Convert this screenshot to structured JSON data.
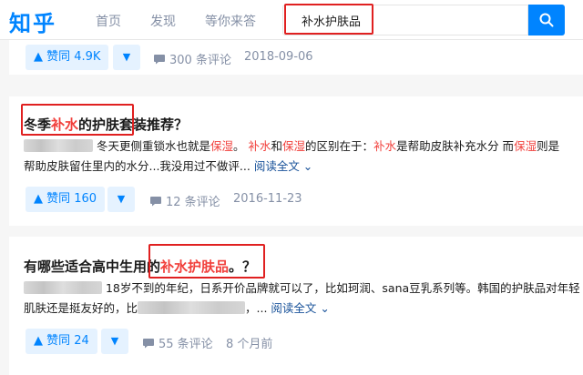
{
  "header": {
    "logo": "知乎",
    "nav": [
      "首页",
      "发现",
      "等你来答"
    ],
    "search_value": "补水护肤品"
  },
  "colors": {
    "brand": "#0084ff",
    "highlight": "#f1403c",
    "annotation": "#e02020"
  },
  "card0": {
    "vote_label": "▲ 赞同 4.9K",
    "vote_down": "▼",
    "comments": "300 条评论",
    "date": "2018-09-06"
  },
  "card1": {
    "title": {
      "a": "冬季",
      "hl": "补水",
      "b": "的护肤套装推荐？"
    },
    "line1": {
      "a": "冬天更侧重锁水也就是",
      "h1": "保湿",
      "b": "。 ",
      "h2": "补水",
      "c": "和",
      "h3": "保湿",
      "d": "的区别在于：",
      "h4": "补水",
      "e": "是帮助皮肤补充水分 而",
      "h5": "保湿",
      "f": "则是"
    },
    "line2": "帮助皮肤留住里内的水分...我没用过不做评...",
    "read_more": "阅读全文 ⌄",
    "vote_label": "▲ 赞同 160",
    "vote_down": "▼",
    "comments": "12 条评论",
    "date": "2016-11-23"
  },
  "card2": {
    "title": {
      "a": "有哪些适合高中生用的",
      "hl": "补水护肤品",
      "b": "。？"
    },
    "line1": "18岁不到的年纪，日系开价品牌就可以了，比如珂润、sana豆乳系列等。韩国的护肤品对年轻",
    "line2a": "肌肤还是挺友好的，比",
    "line2b": "，... ",
    "read_more": "阅读全文 ⌄",
    "vote_label": "▲ 赞同 24",
    "vote_down": "▼",
    "comments": "55 条评论",
    "date": "8 个月前"
  }
}
